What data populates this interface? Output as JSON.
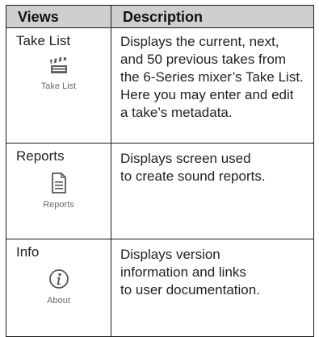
{
  "table": {
    "headers": {
      "views": "Views",
      "description": "Description"
    },
    "rows": [
      {
        "view": "Take List",
        "icon": "clapperboard-icon",
        "icon_caption": "Take List",
        "description": "Displays the current, next,\nand 50 previous takes from\nthe 6-Series mixer’s Take List.\nHere you may enter and edit\na take’s metadata."
      },
      {
        "view": "Reports",
        "icon": "document-icon",
        "icon_caption": "Reports",
        "description": "Displays screen used\nto create sound reports."
      },
      {
        "view": "Info",
        "icon": "info-circle-icon",
        "icon_caption": "About",
        "description": "Displays version\ninformation and links\nto user documentation."
      }
    ]
  },
  "colors": {
    "header_bg": "#cfcfcf",
    "border": "#1a1a1a",
    "icon_gray": "#6a6a6a"
  }
}
